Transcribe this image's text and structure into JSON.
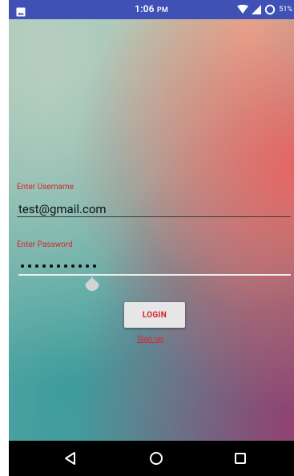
{
  "status_bar": {
    "time": "1:06",
    "ampm": "PM",
    "battery": "51%"
  },
  "username": {
    "label": "Enter Username",
    "value": "test@gmail.com"
  },
  "password": {
    "label": "Enter Password",
    "masked_length": 11
  },
  "login_button": {
    "label": "LOGIN"
  },
  "signup_link": {
    "label": "Sign up"
  },
  "colors": {
    "status_bar": "#3f51b5",
    "accent": "#d9232a",
    "nav_bar": "#000000"
  },
  "icons": {
    "status_left": "image-icon",
    "wifi": "wifi-icon",
    "signal": "signal-icon",
    "battery": "battery-ring-icon",
    "back": "back-triangle-icon",
    "home": "home-circle-icon",
    "recents": "recents-square-icon"
  }
}
